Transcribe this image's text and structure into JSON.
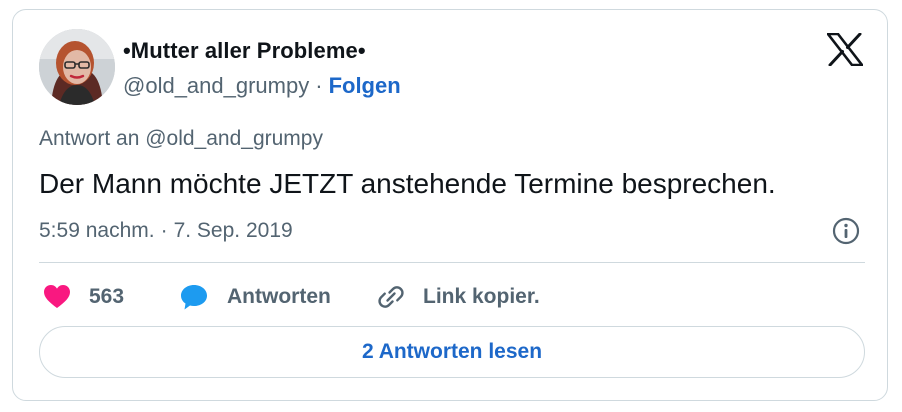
{
  "tweet": {
    "author": {
      "display_name": "•Mutter aller Probleme•",
      "handle": "@old_and_grumpy",
      "separator": "·",
      "follow_label": "Folgen"
    },
    "reply_to": "Antwort an @old_and_grumpy",
    "text": "Der Mann möchte JETZT anstehende Termine besprechen.",
    "time": "5:59 nachm.",
    "meta_separator": "·",
    "date": "7. Sep. 2019"
  },
  "actions": {
    "like_count": "563",
    "reply_label": "Antworten",
    "copy_link_label": "Link kopier.",
    "read_replies_label": "2 Antworten lesen"
  },
  "icons": {
    "brand": "x-logo-icon",
    "info": "info-icon",
    "like": "heart-icon",
    "reply": "speech-bubble-icon",
    "copy": "link-icon"
  },
  "colors": {
    "like": "#f91880",
    "reply": "#1d9bf0",
    "link_accent": "#1d68c9",
    "muted_text": "#536471",
    "border": "#cfd9de"
  }
}
